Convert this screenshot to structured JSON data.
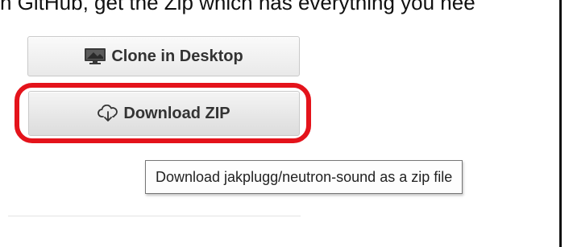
{
  "caption": {
    "text": "n GitHub, get the Zip which has everything you nee"
  },
  "clone_button": {
    "label": "Clone in Desktop",
    "icon": "desktop-monitor-icon"
  },
  "download_button": {
    "label": "Download ZIP",
    "icon": "cloud-download-icon"
  },
  "tooltip": {
    "text": "Download jakplugg/neutron-sound as a zip file"
  },
  "colors": {
    "highlight": "#e4131b",
    "button_text": "#333333",
    "tooltip_border": "#767676"
  }
}
